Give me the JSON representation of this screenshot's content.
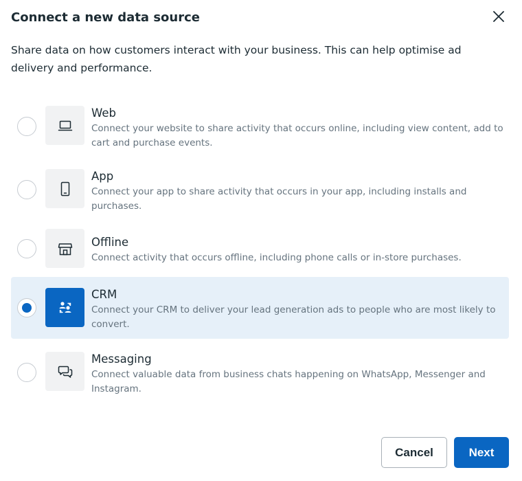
{
  "dialog": {
    "title": "Connect a new data source",
    "description": "Share data on how customers interact with your business. This can help optimise ad delivery and performance."
  },
  "options": [
    {
      "title": "Web",
      "description": "Connect your website to share activity that occurs online, including view content, add to cart and purchase events.",
      "icon": "laptop-icon",
      "selected": false
    },
    {
      "title": "App",
      "description": "Connect your app to share activity that occurs in your app, including installs and purchases.",
      "icon": "mobile-phone-icon",
      "selected": false
    },
    {
      "title": "Offline",
      "description": "Connect activity that occurs offline, including phone calls or in-store purchases.",
      "icon": "store-icon",
      "selected": false
    },
    {
      "title": "CRM",
      "description": "Connect your CRM to deliver your lead generation ads to people who are most likely to convert.",
      "icon": "people-sync-icon",
      "selected": true
    },
    {
      "title": "Messaging",
      "description": "Connect valuable data from business chats happening on WhatsApp, Messenger and Instagram.",
      "icon": "chat-bubbles-icon",
      "selected": false
    }
  ],
  "footer": {
    "cancel_label": "Cancel",
    "next_label": "Next"
  },
  "colors": {
    "accent": "#0a66c2",
    "selected_background": "#e6f0f9",
    "text_primary": "#1c2b33",
    "text_secondary": "#65737e"
  }
}
